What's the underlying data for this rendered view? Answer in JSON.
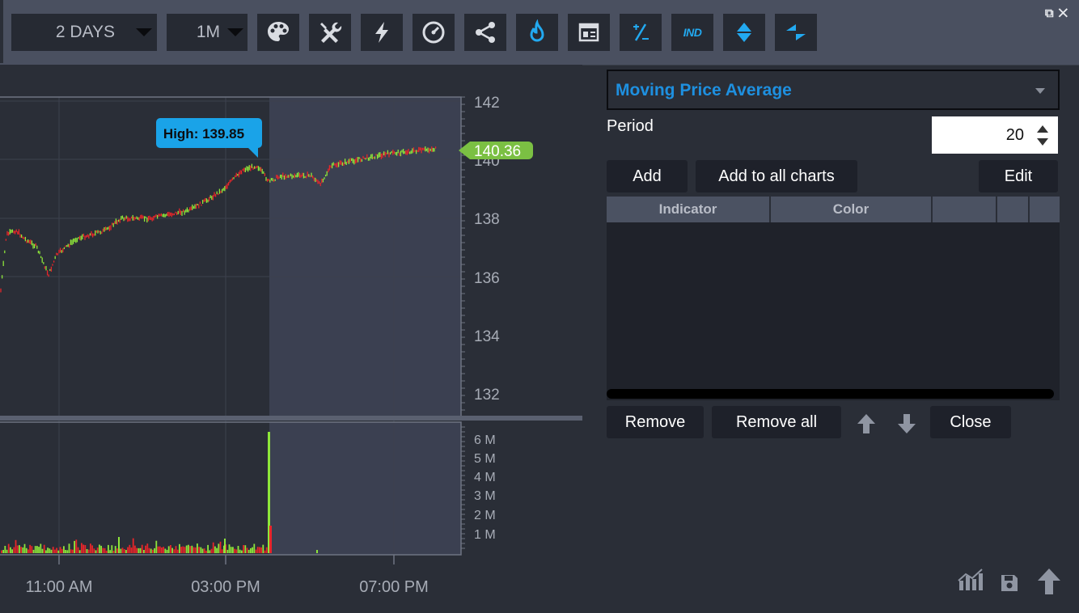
{
  "toolbar": {
    "range_label": "2 DAYS",
    "interval_label": "1M",
    "icons": [
      "palette-icon",
      "tools-icon",
      "lightning-icon",
      "gauge-icon",
      "share-icon",
      "flame-icon",
      "layout-icon",
      "percent-icon",
      "indicators-icon",
      "updown-icon",
      "leftright-icon"
    ],
    "ind_text": "IND",
    "window_icons": [
      "popout-icon",
      "close-icon"
    ]
  },
  "chart": {
    "price_ticks": [
      "142",
      "140",
      "138",
      "136",
      "134",
      "132"
    ],
    "volume_ticks": [
      "6 M",
      "5 M",
      "4 M",
      "3 M",
      "2 M",
      "1 M"
    ],
    "time_labels": [
      "11:00 AM",
      "03:00 PM",
      "07:00 PM"
    ],
    "high_callout": "High: 139.85",
    "last_price": "140.36",
    "colors": {
      "up": "#8ee63a",
      "down": "#e8262a",
      "callout": "#1aa3e8",
      "last": "#7bc043"
    }
  },
  "panel": {
    "indicator_select": "Moving Price Average",
    "period_label": "Period",
    "period_value": "20",
    "add_label": "Add",
    "add_all_label": "Add to all charts",
    "edit_label": "Edit",
    "columns": [
      "Indicator",
      "Color",
      "",
      ""
    ],
    "remove_label": "Remove",
    "remove_all_label": "Remove all",
    "close_label": "Close"
  },
  "footer_icons": [
    "chart-settings-icon",
    "save-icon",
    "upload-icon"
  ]
}
